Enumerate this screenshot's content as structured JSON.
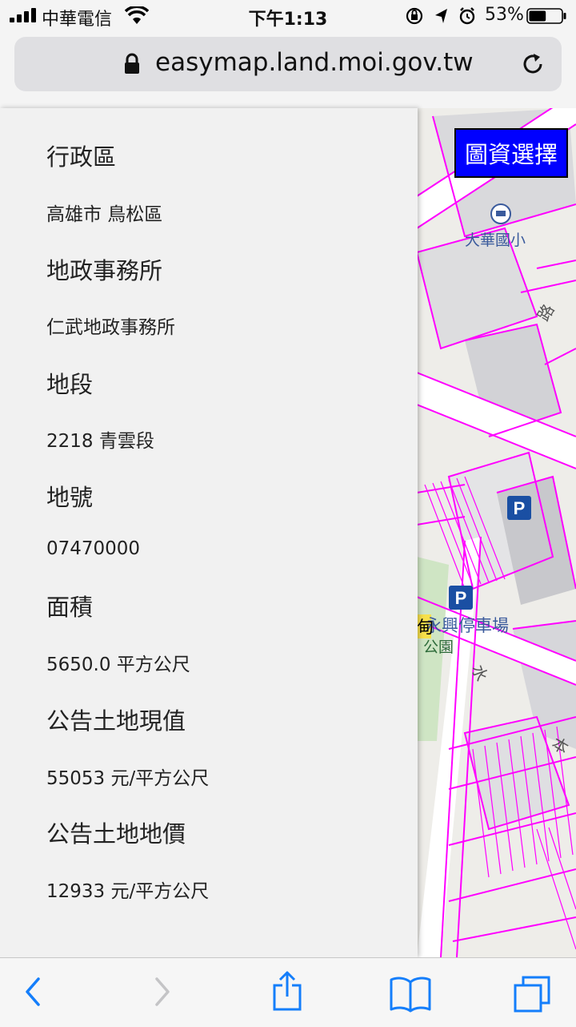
{
  "status_bar": {
    "carrier": "中華電信",
    "time": "下午1:13",
    "battery_percent": "53%",
    "battery_level": 0.53,
    "icons": [
      "signal-icon",
      "wifi-icon",
      "orientation-lock-icon",
      "location-icon",
      "alarm-icon",
      "battery-icon"
    ]
  },
  "browser": {
    "domain": "easymap.land.moi.gov.tw",
    "icons": [
      "lock-icon",
      "reload-icon"
    ]
  },
  "map": {
    "select_button_label": "圖資選擇",
    "labels": {
      "school": "大華國小",
      "parking_lot": "永興停車場",
      "park_fragment": "公園",
      "yellow_tag": "甸",
      "road_1": "路",
      "road_2": "水",
      "road_3": "本"
    }
  },
  "info_panel": {
    "district_label": "行政區",
    "district_value": "高雄市 鳥松區",
    "office_label": "地政事務所",
    "office_value": "仁武地政事務所",
    "section_label": "地段",
    "section_value": "2218 青雲段",
    "lot_label": "地號",
    "lot_value": "07470000",
    "area_label": "面積",
    "area_value": "5650.0 平方公尺",
    "land_value_label": "公告土地現值",
    "land_value_value": "55053 元/平方公尺",
    "land_price_label": "公告土地地價",
    "land_price_value": "12933 元/平方公尺"
  },
  "toolbar": {
    "icons": [
      "back-icon",
      "forward-icon",
      "share-icon",
      "bookmarks-icon",
      "tabs-icon"
    ]
  },
  "colors": {
    "select_button_bg": "#0000ff",
    "parcel_lines": "#ff00ff",
    "ios_blue": "#147efb"
  }
}
